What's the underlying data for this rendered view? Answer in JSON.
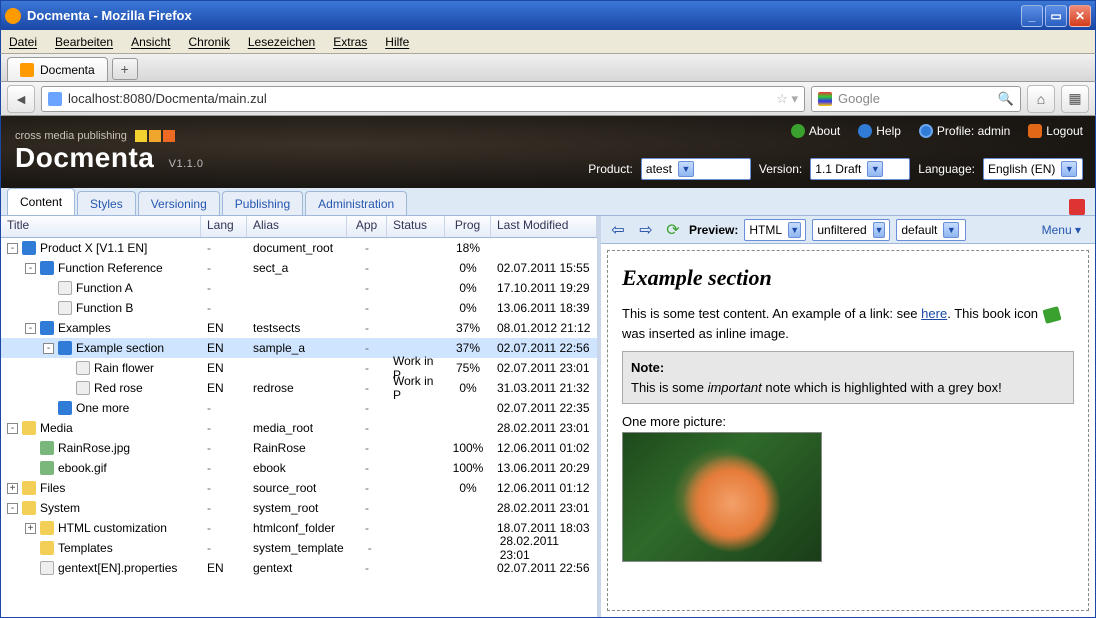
{
  "window_title": "Docmenta - Mozilla Firefox",
  "ff_menu": [
    "Datei",
    "Bearbeiten",
    "Ansicht",
    "Chronik",
    "Lesezeichen",
    "Extras",
    "Hilfe"
  ],
  "tab_title": "Docmenta",
  "url": "localhost:8080/Docmenta/main.zul",
  "search_placeholder": "Google",
  "brand_tag": "cross media publishing",
  "brand_name": "Docmenta",
  "brand_version": "V1.1.0",
  "header_links": {
    "about": "About",
    "help": "Help",
    "profile": "Profile: admin",
    "logout": "Logout"
  },
  "selectors": {
    "product_label": "Product:",
    "product_value": "atest",
    "version_label": "Version:",
    "version_value": "1.1 Draft",
    "language_label": "Language:",
    "language_value": "English (EN)"
  },
  "tabs": [
    "Content",
    "Styles",
    "Versioning",
    "Publishing",
    "Administration"
  ],
  "active_tab": 0,
  "columns": {
    "title": "Title",
    "lang": "Lang",
    "alias": "Alias",
    "app": "App",
    "status": "Status",
    "prog": "Prog",
    "mod": "Last Modified"
  },
  "rows": [
    {
      "d": 0,
      "tw": "-",
      "ic": "book",
      "t": "Product X [V1.1 EN]",
      "lang": "-",
      "alias": "document_root",
      "app": "-",
      "status": "",
      "prog": "18%",
      "mod": ""
    },
    {
      "d": 1,
      "tw": "-",
      "ic": "sect",
      "t": "Function Reference",
      "lang": "-",
      "alias": "sect_a",
      "app": "-",
      "status": "",
      "prog": "0%",
      "mod": "02.07.2011 15:55"
    },
    {
      "d": 2,
      "tw": "",
      "ic": "page",
      "t": "Function A",
      "lang": "-",
      "alias": "",
      "app": "-",
      "status": "",
      "prog": "0%",
      "mod": "17.10.2011 19:29"
    },
    {
      "d": 2,
      "tw": "",
      "ic": "page",
      "t": "Function B",
      "lang": "-",
      "alias": "",
      "app": "-",
      "status": "",
      "prog": "0%",
      "mod": "13.06.2011 18:39"
    },
    {
      "d": 1,
      "tw": "-",
      "ic": "sect",
      "t": "Examples",
      "lang": "EN",
      "alias": "testsects",
      "app": "-",
      "status": "",
      "prog": "37%",
      "mod": "08.01.2012 21:12"
    },
    {
      "d": 2,
      "tw": "-",
      "ic": "sect",
      "t": "Example section",
      "lang": "EN",
      "alias": "sample_a",
      "app": "-",
      "status": "",
      "prog": "37%",
      "mod": "02.07.2011 22:56",
      "sel": true
    },
    {
      "d": 3,
      "tw": "",
      "ic": "page",
      "t": "Rain flower",
      "lang": "EN",
      "alias": "",
      "app": "-",
      "status": "Work in P",
      "prog": "75%",
      "mod": "02.07.2011 23:01"
    },
    {
      "d": 3,
      "tw": "",
      "ic": "page",
      "t": "Red rose",
      "lang": "EN",
      "alias": "redrose",
      "app": "-",
      "status": "Work in P",
      "prog": "0%",
      "mod": "31.03.2011 21:32"
    },
    {
      "d": 2,
      "tw": "",
      "ic": "sect",
      "t": "One more",
      "lang": "-",
      "alias": "",
      "app": "-",
      "status": "",
      "prog": "",
      "mod": "02.07.2011 22:35"
    },
    {
      "d": 0,
      "tw": "-",
      "ic": "folder",
      "t": "Media",
      "lang": "-",
      "alias": "media_root",
      "app": "-",
      "status": "",
      "prog": "",
      "mod": "28.02.2011 23:01"
    },
    {
      "d": 1,
      "tw": "",
      "ic": "img",
      "t": "RainRose.jpg",
      "lang": "-",
      "alias": "RainRose",
      "app": "-",
      "status": "",
      "prog": "100%",
      "mod": "12.06.2011 01:02"
    },
    {
      "d": 1,
      "tw": "",
      "ic": "img",
      "t": "ebook.gif",
      "lang": "-",
      "alias": "ebook",
      "app": "-",
      "status": "",
      "prog": "100%",
      "mod": "13.06.2011 20:29"
    },
    {
      "d": 0,
      "tw": "+",
      "ic": "folder",
      "t": "Files",
      "lang": "-",
      "alias": "source_root",
      "app": "-",
      "status": "",
      "prog": "0%",
      "mod": "12.06.2011 01:12"
    },
    {
      "d": 0,
      "tw": "-",
      "ic": "folder",
      "t": "System",
      "lang": "-",
      "alias": "system_root",
      "app": "-",
      "status": "",
      "prog": "",
      "mod": "28.02.2011 23:01"
    },
    {
      "d": 1,
      "tw": "+",
      "ic": "folder",
      "t": "HTML customization",
      "lang": "-",
      "alias": "htmlconf_folder",
      "app": "-",
      "status": "",
      "prog": "",
      "mod": "18.07.2011 18:03"
    },
    {
      "d": 1,
      "tw": "",
      "ic": "folder",
      "t": "Templates",
      "lang": "-",
      "alias": "system_template",
      "app": "-",
      "status": "",
      "prog": "",
      "mod": "28.02.2011 23:01"
    },
    {
      "d": 1,
      "tw": "",
      "ic": "page",
      "t": "gentext[EN].properties",
      "lang": "EN",
      "alias": "gentext",
      "app": "-",
      "status": "",
      "prog": "",
      "mod": "02.07.2011 22:56"
    }
  ],
  "preview": {
    "label": "Preview:",
    "format": "HTML",
    "filter": "unfiltered",
    "style": "default",
    "menu": "Menu",
    "heading": "Example section",
    "p1a": "This is some test content. An example of a link: see ",
    "p1_link": "here",
    "p1b": ".",
    "p2a": "This book icon ",
    "p2b": " was inserted as inline image.",
    "note_title": "Note:",
    "note_a": "This is some ",
    "note_em": "important",
    "note_b": " note which is highlighted with a grey box!",
    "p3": "One more picture:"
  }
}
